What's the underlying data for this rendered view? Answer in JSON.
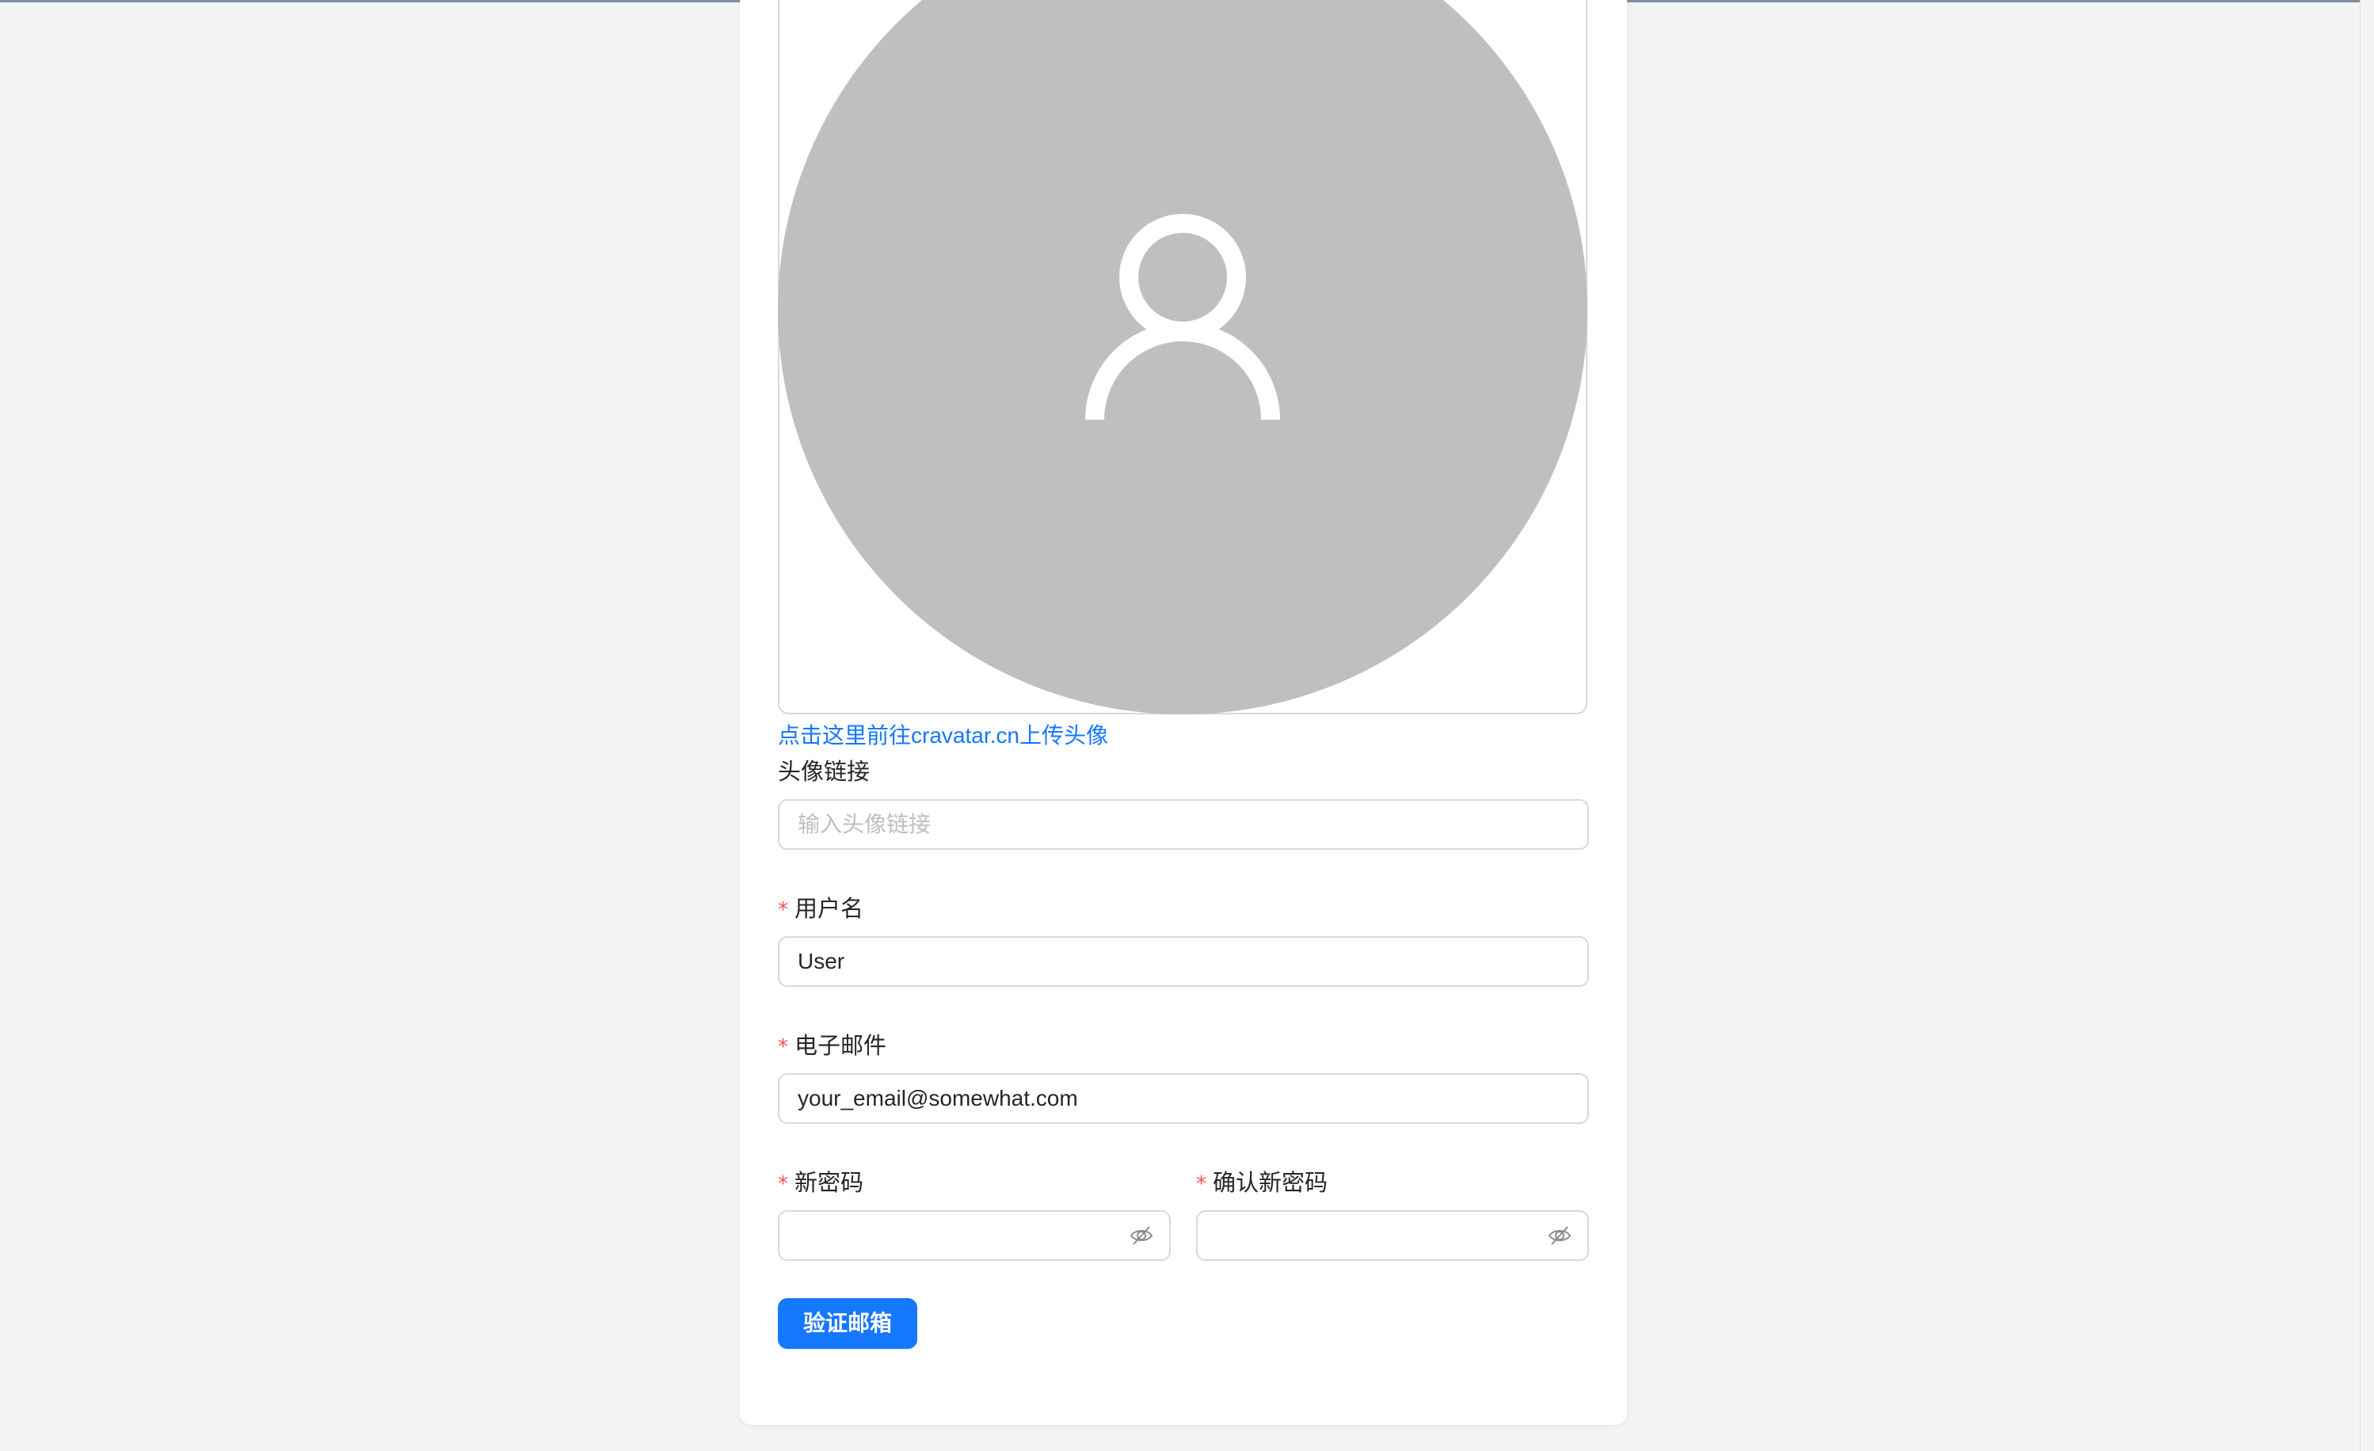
{
  "profile": {
    "avatar_link_text": "点击这里前往cravatar.cn上传头像",
    "avatar_url": {
      "label": "头像链接",
      "placeholder": "输入头像链接",
      "value": ""
    },
    "username": {
      "label": "用户名",
      "required_mark": "*",
      "value": "User"
    },
    "email": {
      "label": "电子邮件",
      "required_mark": "*",
      "value": "your_email@somewhat.com"
    },
    "new_password": {
      "label": "新密码",
      "required_mark": "*",
      "value": ""
    },
    "confirm_password": {
      "label": "确认新密码",
      "required_mark": "*",
      "value": ""
    },
    "verify_button": "验证邮箱"
  },
  "icons": {
    "avatar": "user-placeholder-icon",
    "password_visibility": "eye-invisible-icon"
  },
  "colors": {
    "primary": "#1677ff",
    "required": "#ff4d4f",
    "avatar_bg": "#bfbfbf",
    "page_bg": "#f4f4f4"
  }
}
